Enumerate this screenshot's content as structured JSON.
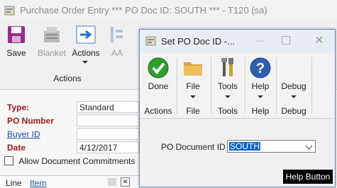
{
  "window": {
    "title": "Purchase Order Entry *** PO Doc ID: SOUTH ***  - T120 (sa)"
  },
  "ribbon": {
    "save": "Save",
    "blanket": "Blanket",
    "actions": "Actions",
    "aa": "AA",
    "group": "Actions"
  },
  "form": {
    "type_label": "Type:",
    "type_value": "Standard",
    "po_number_label": "PO Number",
    "buyer_id_label": "Buyer ID",
    "date_label": "Date",
    "date_value": "4/12/2017",
    "allow_commitments": "Allow Document Commitments"
  },
  "grid": {
    "col_line": "Line",
    "col_item": "Item"
  },
  "dialog": {
    "title": "Set  PO Doc ID  -...",
    "buttons": [
      {
        "label": "Done",
        "group": "Actions"
      },
      {
        "label": "File",
        "group": "File"
      },
      {
        "label": "Tools",
        "group": "Tools"
      },
      {
        "label": "Help",
        "group": "Help"
      },
      {
        "label": "Debug",
        "group": "Debug"
      }
    ],
    "po_doc_id_label": "PO Document ID",
    "po_doc_id_value": "SOUTH",
    "tooltip": "Help Button"
  }
}
